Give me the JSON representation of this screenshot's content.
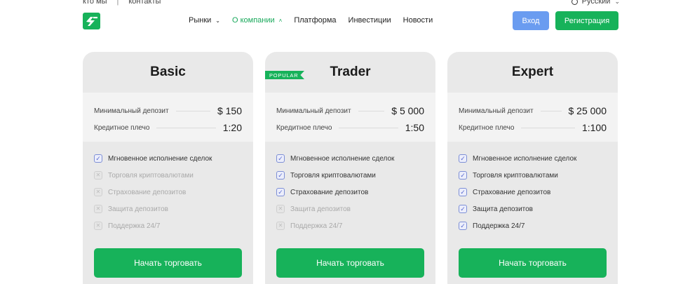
{
  "topbar": {
    "about": "кто мы",
    "separator": "|",
    "contacts": "контакты",
    "language": "Русский"
  },
  "nav": {
    "items": [
      {
        "label": "Рынки",
        "caret": "⌄"
      },
      {
        "label": "О компании",
        "caret": "˄"
      },
      {
        "label": "Платформа"
      },
      {
        "label": "Инвестиции"
      },
      {
        "label": "Новости"
      }
    ]
  },
  "header": {
    "login": "Вход",
    "register": "Регистрация"
  },
  "labels": {
    "min_deposit": "Минимальный депозит",
    "leverage": "Кредитное плечо",
    "popular": "POPULAR",
    "cta": "Начать торговать"
  },
  "features": [
    "Мгновенное исполнение сделок",
    "Торговля криптовалютами",
    "Страхование депозитов",
    "Защита депозитов",
    "Поддержка 24/7"
  ],
  "plans": [
    {
      "name": "Basic",
      "min_deposit": "$ 150",
      "leverage": "1:20",
      "enabled": [
        true,
        false,
        false,
        false,
        false
      ]
    },
    {
      "name": "Trader",
      "min_deposit": "$ 5 000",
      "leverage": "1:50",
      "enabled": [
        true,
        true,
        true,
        false,
        false
      ]
    },
    {
      "name": "Expert",
      "min_deposit": "$ 25 000",
      "leverage": "1:100",
      "enabled": [
        true,
        true,
        true,
        true,
        true
      ]
    }
  ],
  "colors": {
    "brand_green": "#17b25a",
    "login_blue": "#6a9cf0",
    "card_bg": "#e9e9e9"
  }
}
